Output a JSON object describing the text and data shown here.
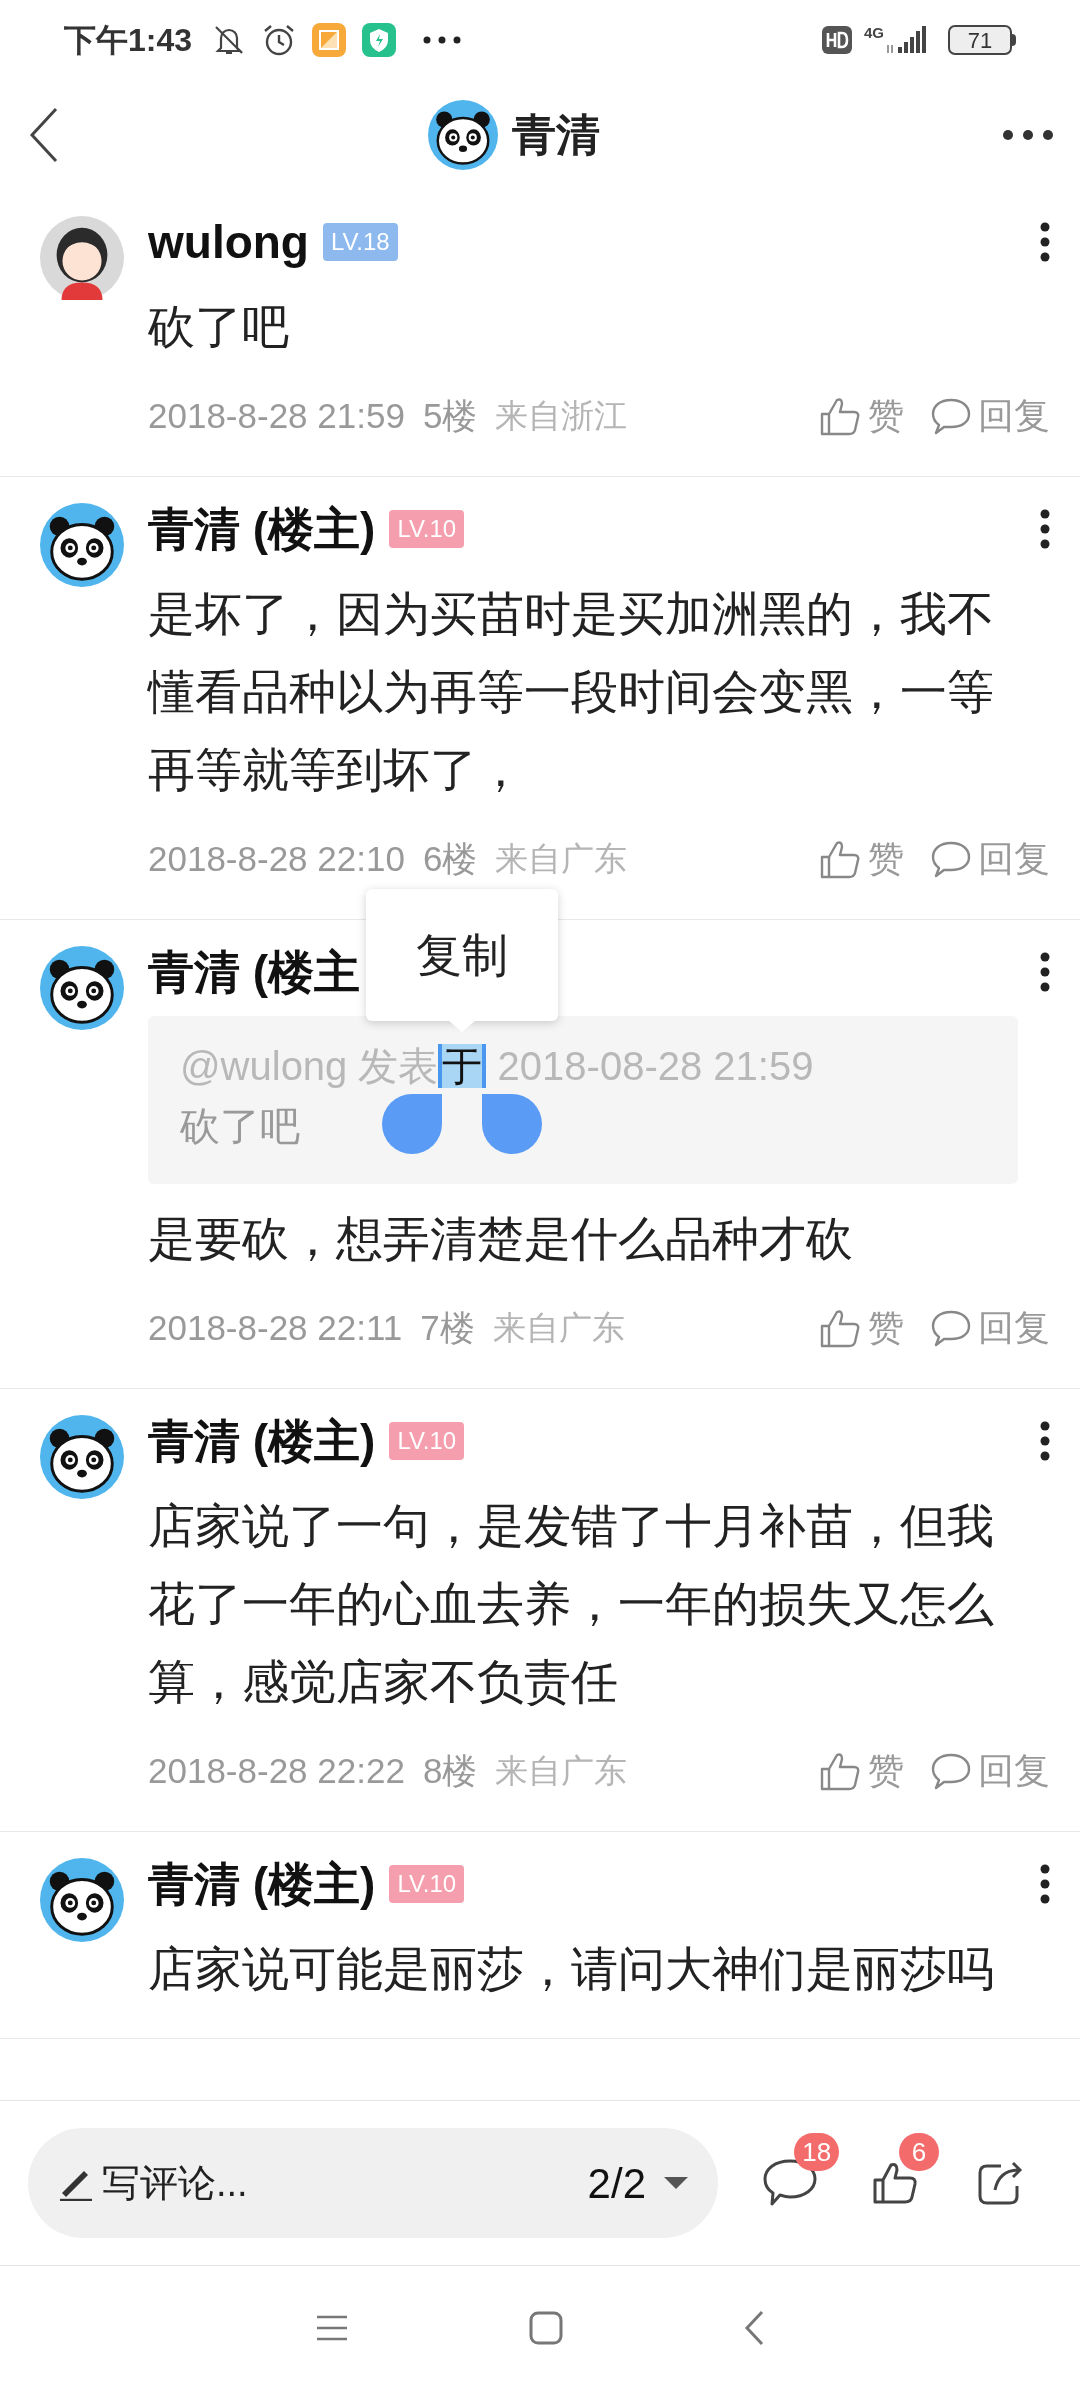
{
  "status_bar": {
    "time": "下午1:43",
    "network": "4G",
    "battery": "71"
  },
  "header": {
    "title": "青清",
    "avatar": {
      "kind": "panda"
    }
  },
  "posts": [
    {
      "avatar": {
        "kind": "girl"
      },
      "author": "wulong",
      "level": {
        "text": "LV.18",
        "color": "#8db9ef"
      },
      "text": "砍了吧",
      "date": "2018-8-28 21:59",
      "floor": "5楼",
      "location": "来自浙江",
      "like": "赞",
      "reply": "回复"
    },
    {
      "avatar": {
        "kind": "panda"
      },
      "author": "青清 (楼主)",
      "level": {
        "text": "LV.10",
        "color": "#f59fae"
      },
      "text": "是坏了，因为买苗时是买加洲黑的，我不懂看品种以为再等一段时间会变黑，一等再等就等到坏了，",
      "date": "2018-8-28 22:10",
      "floor": "6楼",
      "location": "来自广东",
      "like": "赞",
      "reply": "回复"
    },
    {
      "avatar": {
        "kind": "panda"
      },
      "author": "青清 (楼主",
      "quote": {
        "meta": [
          {
            "text": "@wulong 发表",
            "selected": false
          },
          {
            "text": "于",
            "selected": true
          },
          {
            "text": " 2018-08-28 21:59",
            "selected": false
          }
        ],
        "text": "砍了吧"
      },
      "popup": "复制",
      "text": "是要砍，想弄清楚是什么品种才砍",
      "date": "2018-8-28 22:11",
      "floor": "7楼",
      "location": "来自广东",
      "like": "赞",
      "reply": "回复"
    },
    {
      "avatar": {
        "kind": "panda"
      },
      "author": "青清 (楼主)",
      "level": {
        "text": "LV.10",
        "color": "#f59fae"
      },
      "text": "店家说了一句，是发错了十月补苗，但我花了一年的心血去养，一年的损失又怎么算，感觉店家不负责任",
      "date": "2018-8-28 22:22",
      "floor": "8楼",
      "location": "来自广东",
      "like": "赞",
      "reply": "回复"
    },
    {
      "avatar": {
        "kind": "panda"
      },
      "author": "青清 (楼主)",
      "level": {
        "text": "LV.10",
        "color": "#f59fae"
      },
      "text": "店家说可能是丽莎，请问大神们是丽莎吗"
    }
  ],
  "bottom_bar": {
    "placeholder": "写评论...",
    "page": "2/2",
    "comments_badge": "18",
    "likes_badge": "6"
  }
}
